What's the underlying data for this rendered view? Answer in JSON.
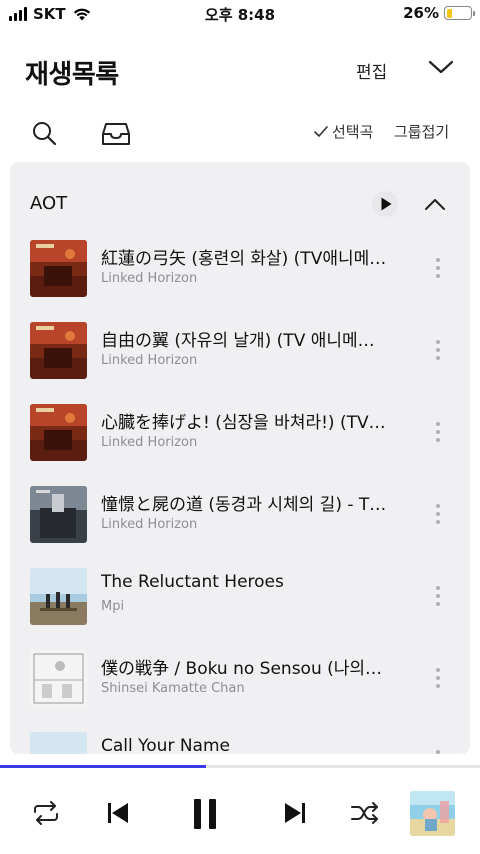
{
  "status_bar": {
    "carrier": "SKT",
    "time": "오후 8:48",
    "battery": "26%",
    "battery_level": 0.26,
    "battery_color": "#f5c518"
  },
  "header": {
    "title": "재생목록",
    "edit_label": "편집",
    "collapse_icon": "chevron-down-icon"
  },
  "toolbar": {
    "search_icon": "search-icon",
    "inbox_icon": "inbox-icon",
    "select_label": "선택곡",
    "group_label": "그룹접기"
  },
  "playlist": {
    "name": "AOT",
    "tracks": [
      {
        "title": "紅蓮の弓矢 (홍련의 화살) (TV애니메…",
        "artist": "Linked Horizon",
        "art": "red"
      },
      {
        "title": "自由の翼 (자유의 날개) (TV 애니메…",
        "artist": "Linked Horizon",
        "art": "red"
      },
      {
        "title": "心臓を捧げよ! (심장을 바쳐라!) (TV…",
        "artist": "Linked Horizon",
        "art": "red"
      },
      {
        "title": "憧憬と屍の道 (동경과 시체의 길) - T…",
        "artist": "Linked Horizon",
        "art": "dark"
      },
      {
        "title": "The Reluctant Heroes",
        "artist": "Mpi",
        "art": "sky"
      },
      {
        "title": "僕の戦争 / Boku no Sensou (나의…",
        "artist": "Shinsei Kamatte Chan",
        "art": "sketch"
      },
      {
        "title": "Call Your Name",
        "artist": "",
        "art": "sky"
      }
    ]
  },
  "player": {
    "progress": 0.43,
    "accent_color": "#3a3ae8",
    "controls": [
      "repeat-icon",
      "previous-icon",
      "pause-icon",
      "next-icon",
      "shuffle-icon"
    ]
  }
}
